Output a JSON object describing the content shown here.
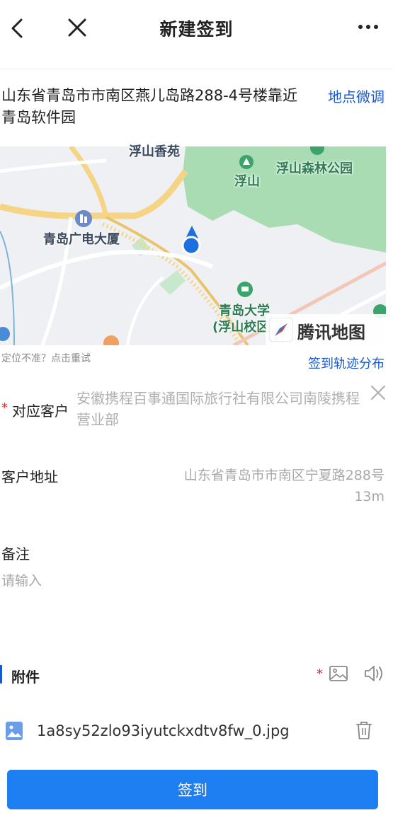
{
  "header": {
    "title": "新建签到",
    "back_icon": "chevron-left-icon",
    "close_icon": "close-icon",
    "more_icon": "more-horizontal-icon"
  },
  "location": {
    "address": "山东省青岛市市南区燕儿岛路288-4号楼靠近青岛软件园",
    "adjust_label": "地点微调"
  },
  "map": {
    "labels": {
      "top": "浮山香苑",
      "fushan": "浮山",
      "park": "浮山森林公园",
      "guangdian": "青岛广电大厦",
      "univ_1": "青岛大学",
      "univ_2": "(浮山校区"
    },
    "brand": "腾讯地图",
    "colors": {
      "park": "#a9dcb3",
      "road": "#f5d485",
      "base": "#eef0f3",
      "marker": "#1d6fe0"
    }
  },
  "relocate_text": "定位不准？点击重试",
  "track_label": "签到轨迹分布",
  "customer": {
    "label": "对应客户",
    "value": "安徽携程百事通国际旅行社有限公司南陵携程营业部"
  },
  "customer_address": {
    "label": "客户地址",
    "value": "山东省青岛市市南区宁夏路288号",
    "distance": "13m"
  },
  "note": {
    "label": "备注",
    "placeholder": "请输入"
  },
  "attachments": {
    "title": "附件",
    "required_mark": "*",
    "files": [
      {
        "name": "1a8sy52zlo93iyutckxdtv8fw_0.jpg"
      }
    ]
  },
  "submit_label": "签到",
  "colors": {
    "accent": "#1d7ff2",
    "link": "#1a59c9",
    "required": "#d93025"
  }
}
